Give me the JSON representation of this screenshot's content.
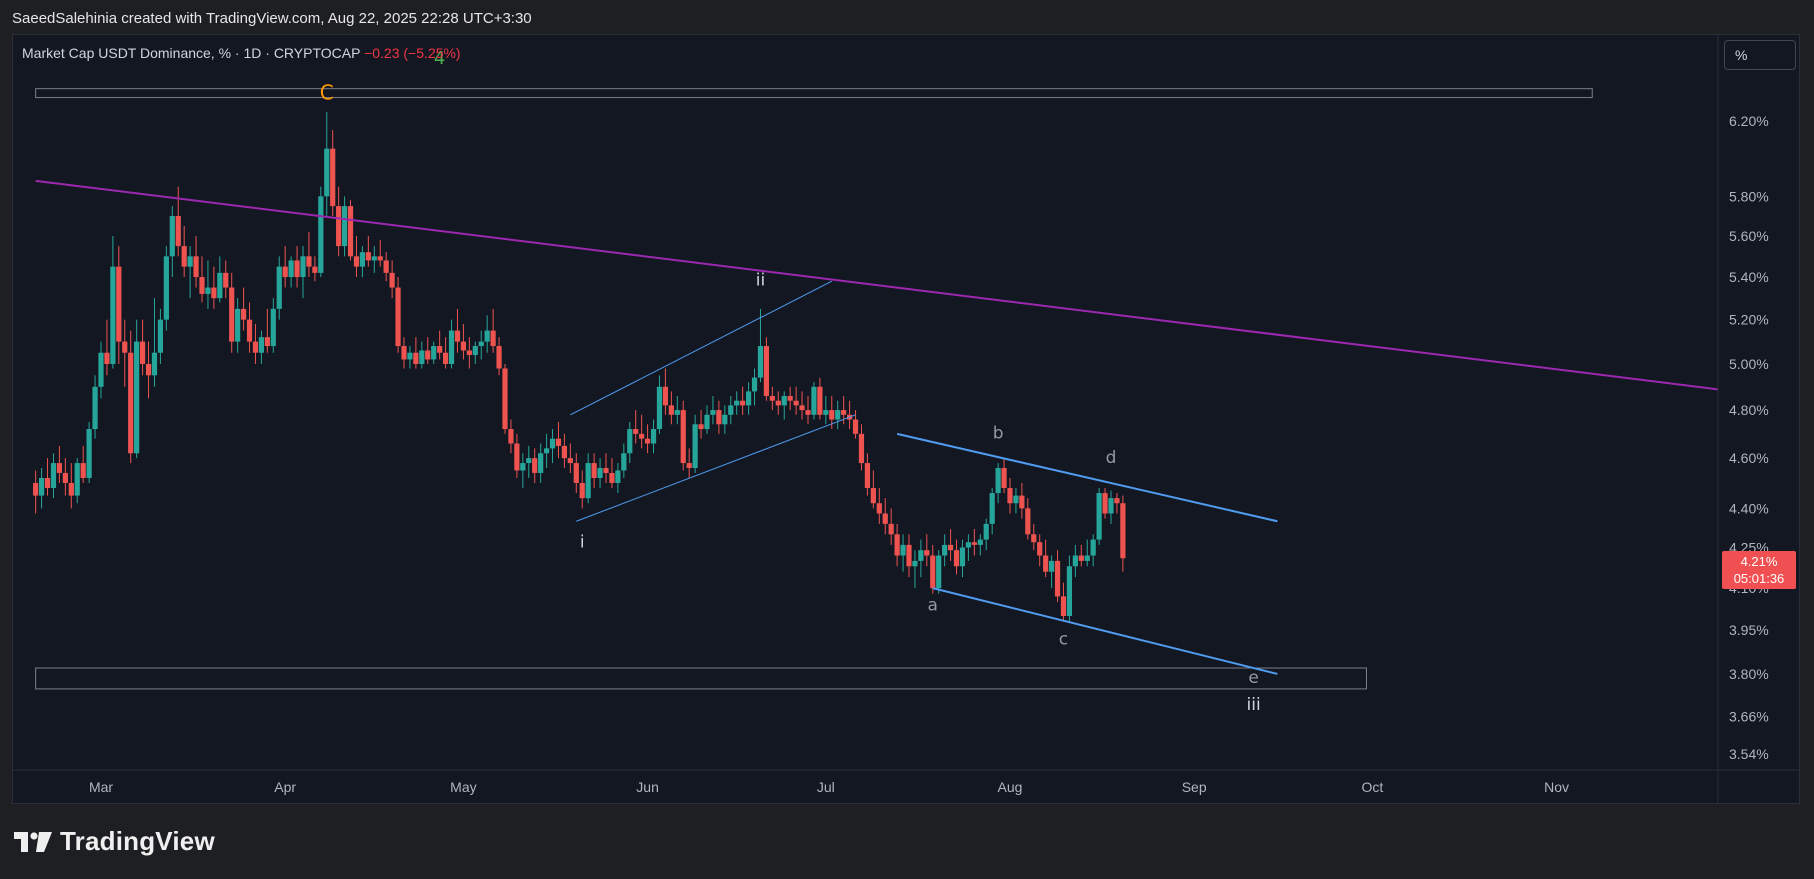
{
  "header": {
    "credit": "SaeedSalehinia created with TradingView.com, Aug 22, 2025 22:28 UTC+3:30"
  },
  "legend": {
    "symbol": "Market Cap USDT Dominance, % · 1D · CRYPTOCAP",
    "change": "−0.23 (−5.25%)"
  },
  "scale_button": {
    "label": "%"
  },
  "price_tag": {
    "price": "4.21%",
    "countdown": "05:01:36"
  },
  "brand": {
    "name": "TradingView"
  },
  "colors": {
    "up": "#26a69a",
    "down": "#ef5350",
    "trendline": "#9c27b0",
    "channel": "#4f9cf0",
    "wave_major": "#ff9800",
    "wave_green": "#4caf50",
    "background": "#131722",
    "price_tag": "#f05052"
  },
  "chart_data": {
    "type": "candlestick",
    "title": "Market Cap USDT Dominance, % · 1D · CRYPTOCAP",
    "y_scale": "log",
    "y_ticks": [
      "6.20%",
      "5.80%",
      "5.60%",
      "5.40%",
      "5.20%",
      "5.00%",
      "4.80%",
      "4.60%",
      "4.40%",
      "4.25%",
      "4.10%",
      "3.95%",
      "3.80%",
      "3.66%",
      "3.54%"
    ],
    "x_ticks": [
      "Mar",
      "Apr",
      "May",
      "Jun",
      "Jul",
      "Aug",
      "Sep",
      "Oct",
      "Nov"
    ],
    "last_price": 4.21,
    "candles": [
      [
        "Feb 18",
        4.5,
        4.55,
        4.38,
        4.45
      ],
      [
        "Feb 19",
        4.45,
        4.56,
        4.4,
        4.52
      ],
      [
        "Feb 20",
        4.52,
        4.6,
        4.45,
        4.48
      ],
      [
        "Feb 21",
        4.48,
        4.62,
        4.44,
        4.58
      ],
      [
        "Feb 22",
        4.58,
        4.65,
        4.5,
        4.54
      ],
      [
        "Feb 23",
        4.54,
        4.6,
        4.45,
        4.5
      ],
      [
        "Feb 24",
        4.5,
        4.58,
        4.4,
        4.45
      ],
      [
        "Feb 25",
        4.45,
        4.6,
        4.42,
        4.58
      ],
      [
        "Feb 26",
        4.58,
        4.65,
        4.5,
        4.52
      ],
      [
        "Feb 27",
        4.52,
        4.75,
        4.5,
        4.72
      ],
      [
        "Feb 28",
        4.72,
        4.95,
        4.68,
        4.9
      ],
      [
        "Mar 1",
        4.9,
        5.1,
        4.85,
        5.05
      ],
      [
        "Mar 2",
        5.05,
        5.2,
        4.95,
        5.0
      ],
      [
        "Mar 3",
        5.0,
        5.6,
        4.98,
        5.45
      ],
      [
        "Mar 4",
        5.45,
        5.55,
        5.0,
        5.1
      ],
      [
        "Mar 5",
        5.1,
        5.2,
        4.9,
        5.05
      ],
      [
        "Mar 6",
        5.05,
        5.15,
        4.58,
        4.62
      ],
      [
        "Mar 7",
        4.62,
        5.2,
        4.6,
        5.1
      ],
      [
        "Mar 8",
        5.1,
        5.2,
        4.95,
        5.0
      ],
      [
        "Mar 9",
        5.0,
        5.1,
        4.85,
        4.95
      ],
      [
        "Mar 10",
        4.95,
        5.3,
        4.9,
        5.05
      ],
      [
        "Mar 11",
        5.05,
        5.25,
        5.0,
        5.2
      ],
      [
        "Mar 12",
        5.2,
        5.55,
        5.15,
        5.5
      ],
      [
        "Mar 13",
        5.5,
        5.75,
        5.4,
        5.7
      ],
      [
        "Mar 14",
        5.7,
        5.85,
        5.5,
        5.55
      ],
      [
        "Mar 15",
        5.55,
        5.65,
        5.4,
        5.45
      ],
      [
        "Mar 16",
        5.45,
        5.55,
        5.3,
        5.5
      ],
      [
        "Mar 17",
        5.5,
        5.6,
        5.35,
        5.4
      ],
      [
        "Mar 18",
        5.4,
        5.5,
        5.28,
        5.32
      ],
      [
        "Mar 19",
        5.32,
        5.48,
        5.25,
        5.35
      ],
      [
        "Mar 20",
        5.35,
        5.45,
        5.25,
        5.3
      ],
      [
        "Mar 21",
        5.3,
        5.5,
        5.28,
        5.42
      ],
      [
        "Mar 22",
        5.42,
        5.48,
        5.3,
        5.35
      ],
      [
        "Mar 23",
        5.35,
        5.42,
        5.05,
        5.1
      ],
      [
        "Mar 24",
        5.1,
        5.3,
        5.05,
        5.25
      ],
      [
        "Mar 25",
        5.25,
        5.35,
        5.15,
        5.2
      ],
      [
        "Mar 26",
        5.2,
        5.28,
        5.05,
        5.1
      ],
      [
        "Mar 27",
        5.1,
        5.18,
        5.0,
        5.05
      ],
      [
        "Mar 28",
        5.05,
        5.15,
        5.0,
        5.12
      ],
      [
        "Mar 29",
        5.12,
        5.25,
        5.05,
        5.08
      ],
      [
        "Mar 30",
        5.08,
        5.3,
        5.05,
        5.25
      ],
      [
        "Mar 31",
        5.25,
        5.5,
        5.2,
        5.45
      ],
      [
        "Apr 1",
        5.45,
        5.55,
        5.35,
        5.4
      ],
      [
        "Apr 2",
        5.4,
        5.5,
        5.35,
        5.48
      ],
      [
        "Apr 3",
        5.48,
        5.55,
        5.35,
        5.4
      ],
      [
        "Apr 4",
        5.4,
        5.55,
        5.3,
        5.5
      ],
      [
        "Apr 5",
        5.5,
        5.62,
        5.4,
        5.45
      ],
      [
        "Apr 6",
        5.45,
        5.5,
        5.38,
        5.42
      ],
      [
        "Apr 7",
        5.42,
        5.85,
        5.4,
        5.8
      ],
      [
        "Apr 8",
        5.8,
        6.25,
        5.7,
        6.05
      ],
      [
        "Apr 9",
        6.05,
        6.15,
        5.7,
        5.75
      ],
      [
        "Apr 10",
        5.75,
        5.85,
        5.5,
        5.55
      ],
      [
        "Apr 11",
        5.55,
        5.8,
        5.5,
        5.75
      ],
      [
        "Apr 12",
        5.75,
        5.78,
        5.48,
        5.5
      ],
      [
        "Apr 13",
        5.5,
        5.6,
        5.4,
        5.45
      ],
      [
        "Apr 14",
        5.45,
        5.55,
        5.4,
        5.52
      ],
      [
        "Apr 15",
        5.52,
        5.6,
        5.45,
        5.48
      ],
      [
        "Apr 16",
        5.48,
        5.55,
        5.42,
        5.5
      ],
      [
        "Apr 17",
        5.5,
        5.58,
        5.45,
        5.48
      ],
      [
        "Apr 18",
        5.48,
        5.52,
        5.38,
        5.42
      ],
      [
        "Apr 19",
        5.42,
        5.48,
        5.3,
        5.35
      ],
      [
        "Apr 20",
        5.35,
        5.4,
        5.05,
        5.08
      ],
      [
        "Apr 21",
        5.08,
        5.12,
        4.98,
        5.02
      ],
      [
        "Apr 22",
        5.02,
        5.08,
        4.98,
        5.05
      ],
      [
        "Apr 23",
        5.05,
        5.12,
        4.98,
        5.0
      ],
      [
        "Apr 24",
        5.0,
        5.1,
        4.98,
        5.06
      ],
      [
        "Apr 25",
        5.06,
        5.12,
        5.0,
        5.02
      ],
      [
        "Apr 26",
        5.02,
        5.1,
        5.0,
        5.08
      ],
      [
        "Apr 27",
        5.08,
        5.15,
        5.02,
        5.05
      ],
      [
        "Apr 28",
        5.05,
        5.12,
        4.98,
        5.0
      ],
      [
        "Apr 29",
        5.0,
        5.2,
        4.98,
        5.15
      ],
      [
        "Apr 30",
        5.15,
        5.25,
        5.05,
        5.1
      ],
      [
        "May 1",
        5.1,
        5.18,
        5.02,
        5.06
      ],
      [
        "May 2",
        5.06,
        5.12,
        4.98,
        5.04
      ],
      [
        "May 3",
        5.04,
        5.1,
        5.0,
        5.08
      ],
      [
        "May 4",
        5.08,
        5.15,
        5.02,
        5.1
      ],
      [
        "May 5",
        5.1,
        5.22,
        5.05,
        5.15
      ],
      [
        "May 6",
        5.15,
        5.25,
        5.05,
        5.08
      ],
      [
        "May 7",
        5.08,
        5.12,
        4.95,
        4.98
      ],
      [
        "May 8",
        4.98,
        5.0,
        4.7,
        4.72
      ],
      [
        "May 9",
        4.72,
        4.76,
        4.62,
        4.66
      ],
      [
        "May 10",
        4.66,
        4.7,
        4.52,
        4.55
      ],
      [
        "May 11",
        4.55,
        4.62,
        4.48,
        4.58
      ],
      [
        "May 12",
        4.58,
        4.65,
        4.52,
        4.6
      ],
      [
        "May 13",
        4.6,
        4.64,
        4.5,
        4.54
      ],
      [
        "May 14",
        4.54,
        4.66,
        4.5,
        4.62
      ],
      [
        "May 15",
        4.62,
        4.7,
        4.56,
        4.64
      ],
      [
        "May 16",
        4.64,
        4.72,
        4.58,
        4.68
      ],
      [
        "May 17",
        4.68,
        4.75,
        4.6,
        4.65
      ],
      [
        "May 18",
        4.65,
        4.7,
        4.56,
        4.6
      ],
      [
        "May 19",
        4.6,
        4.66,
        4.54,
        4.58
      ],
      [
        "May 20",
        4.58,
        4.62,
        4.46,
        4.5
      ],
      [
        "May 21",
        4.5,
        4.55,
        4.4,
        4.44
      ],
      [
        "May 22",
        4.44,
        4.62,
        4.42,
        4.58
      ],
      [
        "May 23",
        4.58,
        4.62,
        4.48,
        4.52
      ],
      [
        "May 24",
        4.52,
        4.6,
        4.48,
        4.56
      ],
      [
        "May 25",
        4.56,
        4.62,
        4.5,
        4.54
      ],
      [
        "May 26",
        4.54,
        4.6,
        4.48,
        4.5
      ],
      [
        "May 27",
        4.5,
        4.58,
        4.46,
        4.55
      ],
      [
        "May 28",
        4.55,
        4.66,
        4.52,
        4.62
      ],
      [
        "May 29",
        4.62,
        4.75,
        4.58,
        4.72
      ],
      [
        "May 30",
        4.72,
        4.8,
        4.66,
        4.7
      ],
      [
        "May 31",
        4.7,
        4.78,
        4.64,
        4.68
      ],
      [
        "Jun 1",
        4.68,
        4.74,
        4.62,
        4.66
      ],
      [
        "Jun 2",
        4.66,
        4.76,
        4.62,
        4.72
      ],
      [
        "Jun 3",
        4.72,
        4.95,
        4.7,
        4.9
      ],
      [
        "Jun 4",
        4.9,
        4.98,
        4.78,
        4.82
      ],
      [
        "Jun 5",
        4.82,
        4.88,
        4.74,
        4.78
      ],
      [
        "Jun 6",
        4.78,
        4.86,
        4.74,
        4.8
      ],
      [
        "Jun 7",
        4.8,
        4.84,
        4.55,
        4.58
      ],
      [
        "Jun 8",
        4.58,
        4.64,
        4.52,
        4.56
      ],
      [
        "Jun 9",
        4.56,
        4.78,
        4.54,
        4.74
      ],
      [
        "Jun 10",
        4.74,
        4.8,
        4.68,
        4.72
      ],
      [
        "Jun 11",
        4.72,
        4.82,
        4.7,
        4.78
      ],
      [
        "Jun 12",
        4.78,
        4.86,
        4.74,
        4.8
      ],
      [
        "Jun 13",
        4.8,
        4.84,
        4.7,
        4.74
      ],
      [
        "Jun 14",
        4.74,
        4.82,
        4.7,
        4.78
      ],
      [
        "Jun 15",
        4.78,
        4.86,
        4.74,
        4.82
      ],
      [
        "Jun 16",
        4.82,
        4.88,
        4.78,
        4.84
      ],
      [
        "Jun 17",
        4.84,
        4.9,
        4.78,
        4.82
      ],
      [
        "Jun 18",
        4.82,
        4.92,
        4.78,
        4.88
      ],
      [
        "Jun 19",
        4.88,
        4.98,
        4.82,
        4.94
      ],
      [
        "Jun 20",
        4.94,
        5.25,
        4.92,
        5.08
      ],
      [
        "Jun 21",
        5.08,
        5.12,
        4.84,
        4.86
      ],
      [
        "Jun 22",
        4.86,
        4.9,
        4.8,
        4.84
      ],
      [
        "Jun 23",
        4.84,
        4.88,
        4.78,
        4.82
      ],
      [
        "Jun 24",
        4.82,
        4.88,
        4.76,
        4.86
      ],
      [
        "Jun 25",
        4.86,
        4.9,
        4.8,
        4.84
      ],
      [
        "Jun 26",
        4.84,
        4.9,
        4.78,
        4.82
      ],
      [
        "Jun 27",
        4.82,
        4.88,
        4.76,
        4.8
      ],
      [
        "Jun 28",
        4.8,
        4.86,
        4.74,
        4.78
      ],
      [
        "Jun 29",
        4.78,
        4.92,
        4.76,
        4.9
      ],
      [
        "Jun 30",
        4.9,
        4.94,
        4.76,
        4.78
      ],
      [
        "Jul 1",
        4.78,
        4.86,
        4.74,
        4.8
      ],
      [
        "Jul 2",
        4.8,
        4.86,
        4.72,
        4.76
      ],
      [
        "Jul 3",
        4.76,
        4.84,
        4.72,
        4.8
      ],
      [
        "Jul 4",
        4.8,
        4.86,
        4.74,
        4.78
      ],
      [
        "Jul 5",
        4.78,
        4.84,
        4.72,
        4.76
      ],
      [
        "Jul 6",
        4.76,
        4.8,
        4.68,
        4.7
      ],
      [
        "Jul 7",
        4.7,
        4.74,
        4.55,
        4.58
      ],
      [
        "Jul 8",
        4.58,
        4.62,
        4.45,
        4.48
      ],
      [
        "Jul 9",
        4.48,
        4.55,
        4.4,
        4.42
      ],
      [
        "Jul 10",
        4.42,
        4.48,
        4.34,
        4.38
      ],
      [
        "Jul 11",
        4.38,
        4.44,
        4.3,
        4.34
      ],
      [
        "Jul 12",
        4.34,
        4.4,
        4.26,
        4.3
      ],
      [
        "Jul 13",
        4.3,
        4.34,
        4.18,
        4.22
      ],
      [
        "Jul 14",
        4.22,
        4.3,
        4.16,
        4.26
      ],
      [
        "Jul 15",
        4.26,
        4.3,
        4.14,
        4.18
      ],
      [
        "Jul 16",
        4.18,
        4.24,
        4.1,
        4.2
      ],
      [
        "Jul 17",
        4.2,
        4.28,
        4.14,
        4.24
      ],
      [
        "Jul 18",
        4.24,
        4.3,
        4.18,
        4.22
      ],
      [
        "Jul 19",
        4.22,
        4.26,
        4.08,
        4.1
      ],
      [
        "Jul 20",
        4.1,
        4.24,
        4.08,
        4.22
      ],
      [
        "Jul 21",
        4.22,
        4.3,
        4.18,
        4.26
      ],
      [
        "Jul 22",
        4.26,
        4.32,
        4.2,
        4.24
      ],
      [
        "Jul 23",
        4.24,
        4.28,
        4.15,
        4.18
      ],
      [
        "Jul 24",
        4.18,
        4.28,
        4.14,
        4.25
      ],
      [
        "Jul 25",
        4.25,
        4.3,
        4.2,
        4.27
      ],
      [
        "Jul 26",
        4.27,
        4.32,
        4.22,
        4.26
      ],
      [
        "Jul 27",
        4.26,
        4.3,
        4.22,
        4.28
      ],
      [
        "Jul 28",
        4.28,
        4.36,
        4.24,
        4.34
      ],
      [
        "Jul 29",
        4.34,
        4.48,
        4.3,
        4.46
      ],
      [
        "Jul 30",
        4.46,
        4.58,
        4.42,
        4.56
      ],
      [
        "Jul 31",
        4.56,
        4.6,
        4.46,
        4.48
      ],
      [
        "Aug 1",
        4.48,
        4.52,
        4.38,
        4.42
      ],
      [
        "Aug 2",
        4.42,
        4.48,
        4.38,
        4.45
      ],
      [
        "Aug 3",
        4.45,
        4.5,
        4.36,
        4.4
      ],
      [
        "Aug 4",
        4.4,
        4.44,
        4.28,
        4.3
      ],
      [
        "Aug 5",
        4.3,
        4.34,
        4.24,
        4.27
      ],
      [
        "Aug 6",
        4.27,
        4.3,
        4.18,
        4.22
      ],
      [
        "Aug 7",
        4.22,
        4.28,
        4.14,
        4.16
      ],
      [
        "Aug 8",
        4.16,
        4.22,
        4.1,
        4.2
      ],
      [
        "Aug 9",
        4.2,
        4.24,
        4.05,
        4.07
      ],
      [
        "Aug 10",
        4.07,
        4.12,
        3.98,
        4.0
      ],
      [
        "Aug 11",
        4.0,
        4.22,
        3.98,
        4.18
      ],
      [
        "Aug 12",
        4.18,
        4.26,
        4.14,
        4.22
      ],
      [
        "Aug 13",
        4.22,
        4.26,
        4.18,
        4.2
      ],
      [
        "Aug 14",
        4.2,
        4.28,
        4.18,
        4.22
      ],
      [
        "Aug 15",
        4.22,
        4.3,
        4.18,
        4.28
      ],
      [
        "Aug 16",
        4.28,
        4.48,
        4.26,
        4.46
      ],
      [
        "Aug 17",
        4.46,
        4.48,
        4.36,
        4.38
      ],
      [
        "Aug 18",
        4.38,
        4.47,
        4.34,
        4.44
      ],
      [
        "Aug 19",
        4.44,
        4.46,
        4.38,
        4.42
      ],
      [
        "Aug 20",
        4.42,
        4.45,
        4.16,
        4.21
      ]
    ],
    "drawings": {
      "trendline": {
        "label": "purple descending trendline",
        "from": [
          "Feb 18",
          5.88
        ],
        "to": [
          "Dec 1",
          4.88
        ]
      },
      "channel_upper": {
        "from": [
          "May 19",
          4.78
        ],
        "to": [
          "Jul 2",
          5.38
        ]
      },
      "channel_lower": {
        "from": [
          "May 20",
          4.35
        ],
        "to": [
          "Jul 6",
          4.78
        ]
      },
      "wedge_upper": {
        "from": [
          "Jul 13",
          4.7
        ],
        "to": [
          "Sep 15",
          4.35
        ]
      },
      "wedge_lower": {
        "from": [
          "Jul 19",
          4.1
        ],
        "to": [
          "Sep 15",
          3.8
        ]
      },
      "box_top": {
        "from": [
          "Feb 18",
          6.38
        ],
        "to": [
          "Nov 7",
          6.33
        ]
      },
      "box_bottom": {
        "from": [
          "Feb 18",
          3.82
        ],
        "to": [
          "Sep 30",
          3.75
        ]
      }
    },
    "annotations": [
      {
        "text": "C",
        "date": "Apr 8",
        "price": 6.32,
        "role": "wave_major"
      },
      {
        "text": "4",
        "date": "Apr 27",
        "price": 6.52,
        "role": "wave_green"
      },
      {
        "text": "ii",
        "date": "Jun 20",
        "price": 5.36,
        "role": "label_white"
      },
      {
        "text": "i",
        "date": "May 21",
        "price": 4.25,
        "role": "label_white"
      },
      {
        "text": "a",
        "date": "Jul 19",
        "price": 4.02,
        "role": "label_grey"
      },
      {
        "text": "b",
        "date": "Jul 30",
        "price": 4.68,
        "role": "label_grey"
      },
      {
        "text": "c",
        "date": "Aug 10",
        "price": 3.9,
        "role": "label_grey"
      },
      {
        "text": "d",
        "date": "Aug 18",
        "price": 4.58,
        "role": "label_grey"
      },
      {
        "text": "e",
        "date": "Sep 11",
        "price": 3.77,
        "role": "label_grey"
      },
      {
        "text": "iii",
        "date": "Sep 11",
        "price": 3.68,
        "role": "label_white"
      }
    ]
  }
}
